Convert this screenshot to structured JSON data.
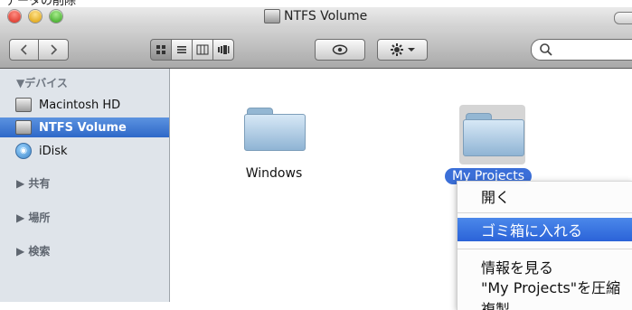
{
  "top_caption": "データの削除",
  "window": {
    "title": "NTFS Volume"
  },
  "sidebar": {
    "devices_header": "▼デバイス",
    "items": [
      {
        "label": "Macintosh HD"
      },
      {
        "label": "NTFS Volume"
      },
      {
        "label": "iDisk"
      }
    ],
    "groups": [
      {
        "label": "▶ 共有"
      },
      {
        "label": "▶ 場所"
      },
      {
        "label": "▶ 検索"
      }
    ]
  },
  "content": {
    "files": [
      {
        "name": "Windows"
      },
      {
        "name": "My Projects"
      }
    ]
  },
  "context_menu": {
    "items": [
      {
        "label": "開く"
      },
      {
        "label": "ゴミ箱に入れる"
      },
      {
        "label": "情報を見る"
      },
      {
        "label": "\"My Projects\"を圧縮"
      },
      {
        "label": "複製"
      }
    ]
  },
  "colors": {
    "selection": "#3b6fd8",
    "menu_highlight": "#2b63d8",
    "sidebar_bg": "#dfe4ea"
  },
  "icons": {
    "traffic_lights": [
      "close-button-icon",
      "minimize-button-icon",
      "zoom-button-icon"
    ],
    "toolbar": [
      "back-icon",
      "forward-icon",
      "icon-view-icon",
      "list-view-icon",
      "column-view-icon",
      "coverflow-view-icon",
      "quick-look-eye-icon",
      "action-gear-icon",
      "search-icon"
    ]
  }
}
